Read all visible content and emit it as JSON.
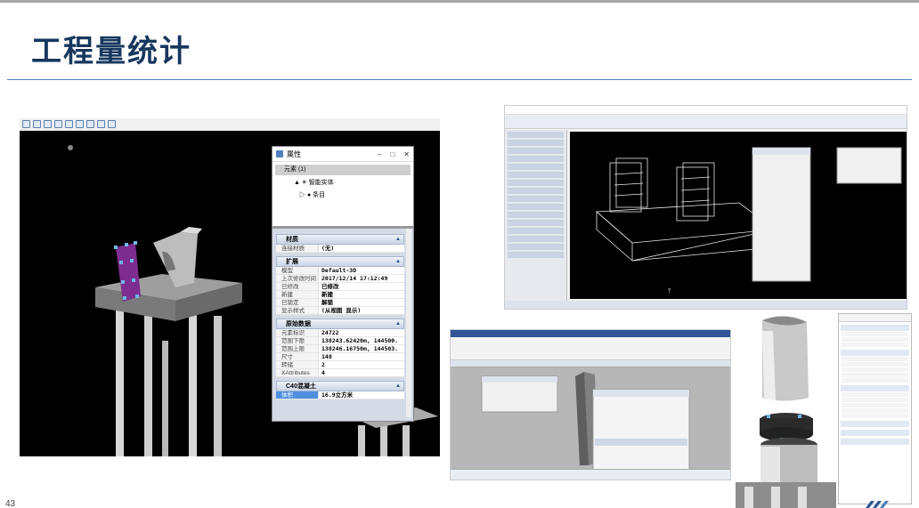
{
  "slide": {
    "title": "工程量统计",
    "page_number": "43"
  },
  "colors": {
    "title": "#17375e",
    "accent_rule": "#4f81bd",
    "viewport_bg": "#000000",
    "selection": "#4f8fe0"
  },
  "properties_dialog": {
    "title": "属性",
    "tree_root": "元素 (1)",
    "tree_child": "智能实体",
    "tree_leaf": "条目",
    "groups": [
      {
        "label": "材质",
        "rows": [
          {
            "key": "连接材质",
            "value": "(无)"
          }
        ]
      },
      {
        "label": "扩展",
        "rows": [
          {
            "key": "模型",
            "value": "Default-3D"
          },
          {
            "key": "上次修改时间",
            "value": "2017/12/14 17:12:49"
          },
          {
            "key": "已修改",
            "value": "已修改"
          },
          {
            "key": "新建",
            "value": "新建"
          },
          {
            "key": "已锁定",
            "value": "解锁"
          },
          {
            "key": "显示样式",
            "value": "(从视图 显示)"
          }
        ]
      },
      {
        "label": "原始数据",
        "rows": [
          {
            "key": "元素标识",
            "value": "24722"
          },
          {
            "key": "范围下限",
            "value": "138243.62420m, 144500."
          },
          {
            "key": "范围上限",
            "value": "138246.16750m, 144503."
          },
          {
            "key": "尺寸",
            "value": "148"
          },
          {
            "key": "转储",
            "value": "2"
          },
          {
            "key": "XAttributes",
            "value": "4"
          }
        ]
      },
      {
        "label": "C40混凝土",
        "rows": [
          {
            "key": "体积",
            "value": "16.9立方米"
          }
        ]
      }
    ]
  }
}
